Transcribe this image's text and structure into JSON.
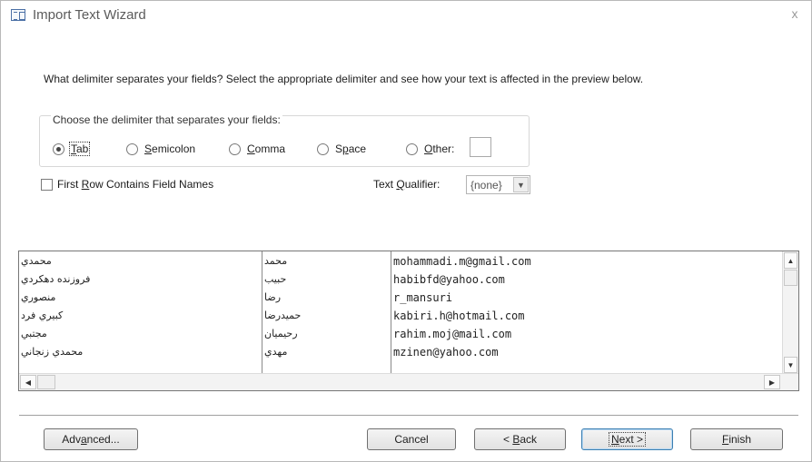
{
  "window": {
    "title": "Import Text Wizard",
    "close_glyph": "x"
  },
  "prompt": "What delimiter separates your fields? Select the appropriate delimiter and see how your text is affected in the preview below.",
  "delimiter_group": {
    "legend": "Choose the delimiter that separates your fields:",
    "options": [
      {
        "pre": "",
        "key": "T",
        "post": "ab",
        "selected": true
      },
      {
        "pre": "",
        "key": "S",
        "post": "emicolon",
        "selected": false
      },
      {
        "pre": "",
        "key": "C",
        "post": "omma",
        "selected": false
      },
      {
        "pre": "S",
        "key": "p",
        "post": "ace",
        "selected": false
      },
      {
        "pre": "",
        "key": "O",
        "post": "ther:",
        "selected": false
      }
    ],
    "other_value": ""
  },
  "first_row": {
    "pre": "First ",
    "key": "R",
    "post": "ow Contains Field Names",
    "checked": false
  },
  "text_qualifier": {
    "pre": "Text ",
    "key": "Q",
    "post": "ualifier:",
    "value": "{none}"
  },
  "preview": {
    "rows": [
      [
        "محمدي",
        "محمد",
        "mohammadi.m@gmail.com"
      ],
      [
        "فروزنده دهكردي",
        "حبيب",
        "habibfd@yahoo.com"
      ],
      [
        "منصوري",
        "رضا",
        "r_mansuri"
      ],
      [
        "كبيري فرد",
        "حميدرضا",
        "kabiri.h@hotmail.com"
      ],
      [
        "مجتبي",
        "رحيميان",
        "rahim.moj@mail.com"
      ],
      [
        "محمدي زنجاني",
        "مهدي",
        "mzinen@yahoo.com"
      ]
    ]
  },
  "buttons": {
    "advanced": {
      "pre": "Adv",
      "key": "a",
      "post": "nced..."
    },
    "cancel": "Cancel",
    "back": {
      "pre": "< ",
      "key": "B",
      "post": "ack"
    },
    "next": {
      "pre": "",
      "key": "N",
      "post": "ext >"
    },
    "finish": {
      "pre": "",
      "key": "F",
      "post": "inish"
    }
  }
}
